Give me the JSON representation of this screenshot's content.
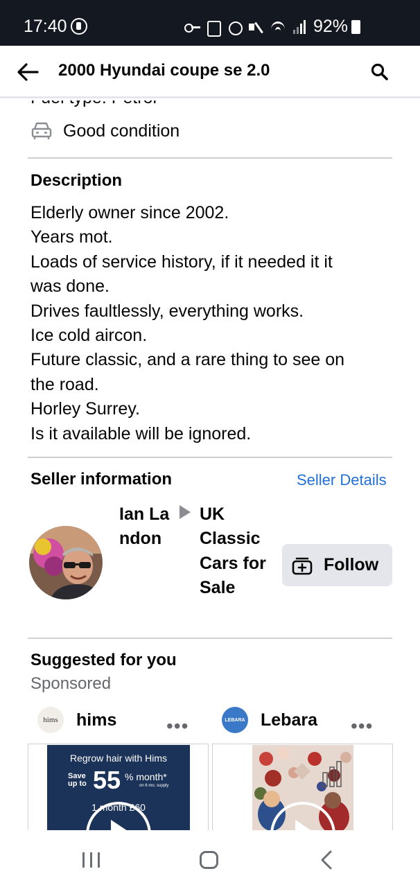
{
  "status_bar": {
    "time": "17:40",
    "battery": "92%",
    "icons": [
      "key-icon",
      "box-icon",
      "alarm-icon",
      "mute-icon",
      "wifi-icon",
      "signal-icon",
      "battery-icon"
    ]
  },
  "header": {
    "title": "2000 Hyundai coupe se 2.0",
    "back_icon": "arrow-left-icon",
    "search_icon": "search-icon"
  },
  "details": {
    "fuel_type": "Fuel type: Petrol",
    "condition": "Good condition"
  },
  "description": {
    "title": "Description",
    "lines": [
      "Elderly owner since 2002.",
      "Years mot.",
      "Loads of service history, if it needed it it",
      "was done.",
      "Drives faultlessly, everything works.",
      "Ice cold aircon.",
      "Future classic, and a rare thing to see on",
      "the road.",
      "Horley Surrey.",
      "Is it available will be ignored."
    ]
  },
  "seller": {
    "title": "Seller information",
    "details_link": "Seller Details",
    "name": "Ian Landon",
    "group": "UK Classic Cars for Sale",
    "follow_label": "Follow"
  },
  "suggested": {
    "title": "Suggested for you",
    "sponsored": "Sponsored",
    "ads": [
      {
        "name": "hims",
        "logo_text": "hims",
        "more": "•••",
        "headline": "Regrow hair with Hims",
        "save_prefix": "Save up to",
        "save_value": "55",
        "save_suffix": "% month*",
        "save_note": "on 6 mo. supply",
        "price_line": "1 month £60"
      },
      {
        "name": "Lebara",
        "logo_text": "LEBARA",
        "more": "•••"
      }
    ]
  },
  "colors": {
    "link": "#216fdb",
    "status_bar_bg": "#141820",
    "button_bg": "#e4e6eb",
    "divider": "#ced0d4",
    "secondary_text": "#65676b"
  }
}
